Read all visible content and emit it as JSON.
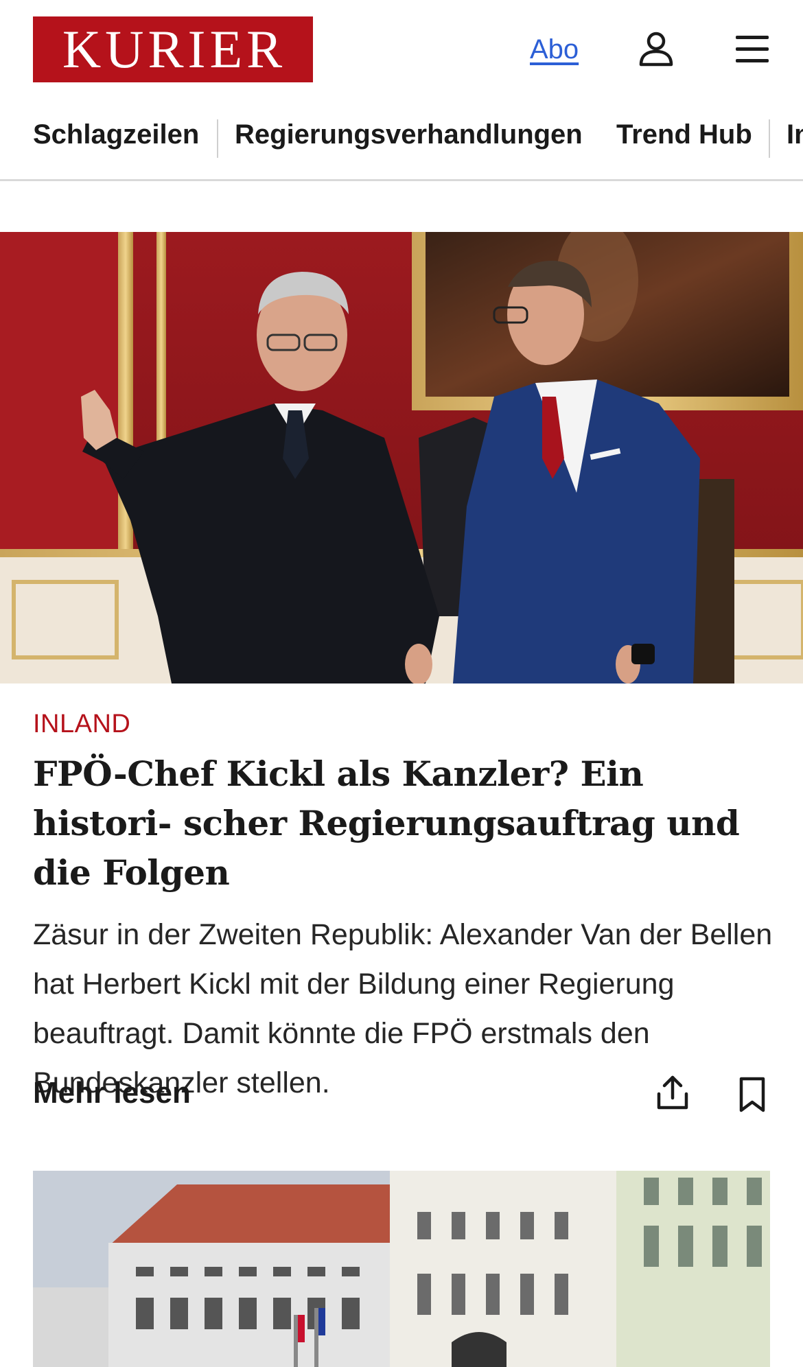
{
  "header": {
    "logo_text": "KURIER",
    "abo_label": "Abo",
    "brand_color": "#b5121b",
    "link_color": "#2c5fd6",
    "icons": [
      "user-icon",
      "hamburger-menu-icon"
    ]
  },
  "nav": {
    "items": [
      {
        "label": "Schlagzeilen"
      },
      {
        "label": "Regierungsverhandlungen"
      },
      {
        "label": "Trend Hub"
      },
      {
        "label": "In"
      }
    ]
  },
  "article": {
    "category": "INLAND",
    "headline": "FPÖ-Chef Kickl als Kanzler? Ein histori- scher Regierungsauftrag und die Folgen",
    "teaser": "Zäsur in der Zweiten Republik: Alexander Van der Bellen hat Herbert Kickl mit der Bildung einer Regierung beauftragt. Damit könnte die FPÖ erstmals den Bundeskanzler stellen.",
    "read_more_label": "Mehr lesen",
    "icons": [
      "share-icon",
      "bookmark-icon"
    ]
  }
}
